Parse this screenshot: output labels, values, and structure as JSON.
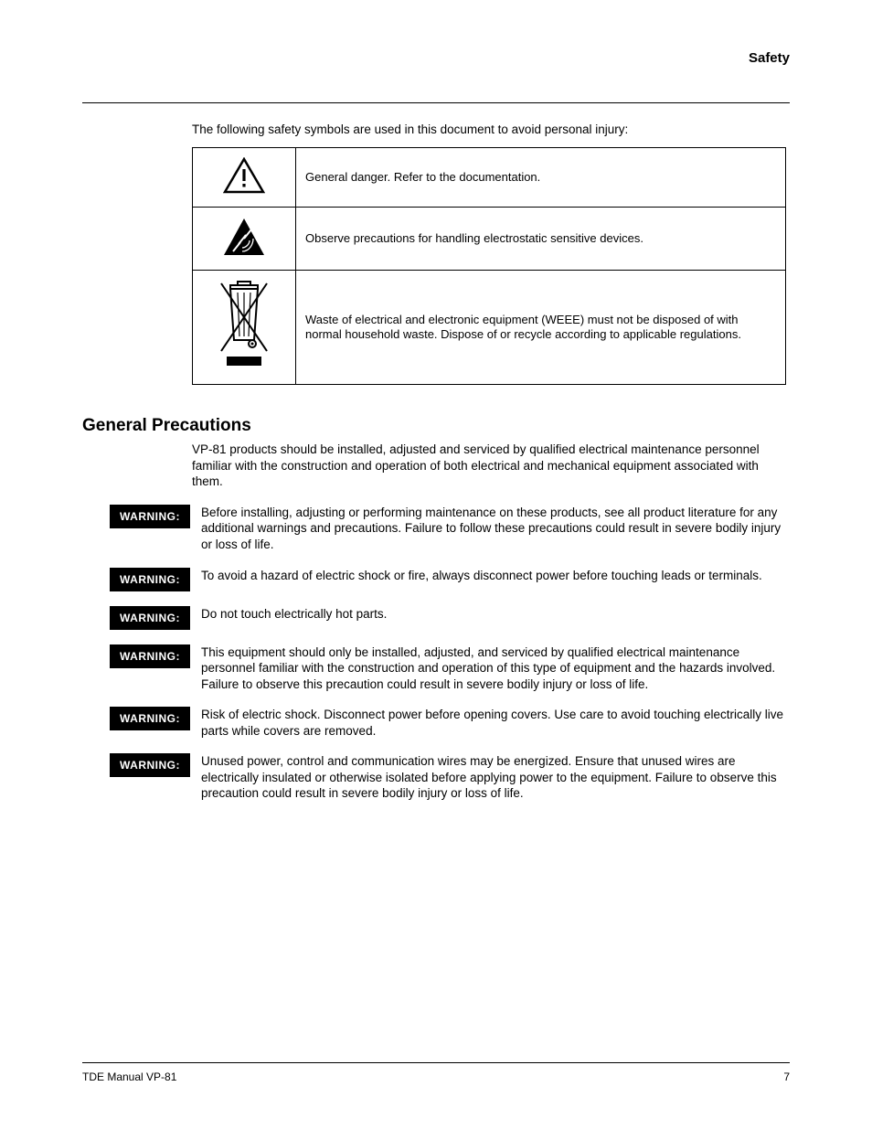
{
  "header": {
    "title": "Safety"
  },
  "intro": "The following safety symbols are used in this document to avoid personal injury:",
  "table": {
    "rows": [
      {
        "desc": "General danger. Refer to the documentation."
      },
      {
        "desc": "Observe precautions for handling electrostatic sensitive devices."
      },
      {
        "desc": "Waste of electrical and electronic equipment (WEEE) must not be disposed of with normal household waste. Dispose of or recycle according to applicable regulations."
      }
    ]
  },
  "section1": {
    "heading": "General Precautions",
    "text": "VP-81 products should be installed, adjusted and serviced by qualified electrical maintenance personnel familiar with the construction and operation of both electrical and mechanical equipment associated with them."
  },
  "warnings": [
    {
      "label": "WARNING:",
      "text": "Before installing, adjusting or performing maintenance on these products, see all product literature for any additional warnings and precautions. Failure to follow these precautions could result in severe bodily injury or loss of life."
    },
    {
      "label": "WARNING:",
      "text": "To avoid a hazard of electric shock or fire, always disconnect power before touching leads or terminals."
    },
    {
      "label": "WARNING:",
      "text": "Do not touch electrically hot parts."
    },
    {
      "label": "WARNING:",
      "text": "This equipment should only be installed, adjusted, and serviced by qualified electrical maintenance personnel familiar with the construction and operation of this type of equipment and the hazards involved. Failure to observe this precaution could result in severe bodily injury or loss of life."
    },
    {
      "label": "WARNING:",
      "text": "Risk of electric shock. Disconnect power before opening covers. Use care to avoid touching electrically live parts while covers are removed."
    },
    {
      "label": "WARNING:",
      "text": "Unused power, control and communication wires may be energized. Ensure that unused wires are electrically insulated or otherwise isolated before applying power to the equipment. Failure to observe this precaution could result in severe bodily injury or loss of life."
    }
  ],
  "footer": {
    "manual": "TDE Manual VP-81",
    "page": "7"
  }
}
